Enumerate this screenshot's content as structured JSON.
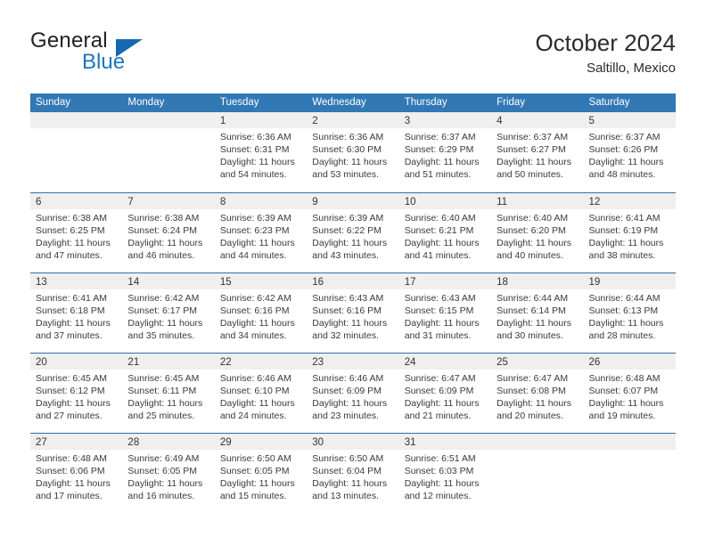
{
  "brand": {
    "name_top": "General",
    "name_bottom": "Blue",
    "triangle_color": "#1668b0",
    "blue_color": "#1b76bc"
  },
  "header": {
    "title": "October 2024",
    "subtitle": "Saltillo, Mexico"
  },
  "theme": {
    "header_bar": "#3178b5",
    "week_divider": "#2f6fa8",
    "day_band": "#efefef"
  },
  "weekdays": [
    "Sunday",
    "Monday",
    "Tuesday",
    "Wednesday",
    "Thursday",
    "Friday",
    "Saturday"
  ],
  "weeks": [
    [
      {
        "day": "",
        "empty": true
      },
      {
        "day": "",
        "empty": true
      },
      {
        "day": "1",
        "sunrise": "Sunrise: 6:36 AM",
        "sunset": "Sunset: 6:31 PM",
        "daylight1": "Daylight: 11 hours",
        "daylight2": "and 54 minutes."
      },
      {
        "day": "2",
        "sunrise": "Sunrise: 6:36 AM",
        "sunset": "Sunset: 6:30 PM",
        "daylight1": "Daylight: 11 hours",
        "daylight2": "and 53 minutes."
      },
      {
        "day": "3",
        "sunrise": "Sunrise: 6:37 AM",
        "sunset": "Sunset: 6:29 PM",
        "daylight1": "Daylight: 11 hours",
        "daylight2": "and 51 minutes."
      },
      {
        "day": "4",
        "sunrise": "Sunrise: 6:37 AM",
        "sunset": "Sunset: 6:27 PM",
        "daylight1": "Daylight: 11 hours",
        "daylight2": "and 50 minutes."
      },
      {
        "day": "5",
        "sunrise": "Sunrise: 6:37 AM",
        "sunset": "Sunset: 6:26 PM",
        "daylight1": "Daylight: 11 hours",
        "daylight2": "and 48 minutes."
      }
    ],
    [
      {
        "day": "6",
        "sunrise": "Sunrise: 6:38 AM",
        "sunset": "Sunset: 6:25 PM",
        "daylight1": "Daylight: 11 hours",
        "daylight2": "and 47 minutes."
      },
      {
        "day": "7",
        "sunrise": "Sunrise: 6:38 AM",
        "sunset": "Sunset: 6:24 PM",
        "daylight1": "Daylight: 11 hours",
        "daylight2": "and 46 minutes."
      },
      {
        "day": "8",
        "sunrise": "Sunrise: 6:39 AM",
        "sunset": "Sunset: 6:23 PM",
        "daylight1": "Daylight: 11 hours",
        "daylight2": "and 44 minutes."
      },
      {
        "day": "9",
        "sunrise": "Sunrise: 6:39 AM",
        "sunset": "Sunset: 6:22 PM",
        "daylight1": "Daylight: 11 hours",
        "daylight2": "and 43 minutes."
      },
      {
        "day": "10",
        "sunrise": "Sunrise: 6:40 AM",
        "sunset": "Sunset: 6:21 PM",
        "daylight1": "Daylight: 11 hours",
        "daylight2": "and 41 minutes."
      },
      {
        "day": "11",
        "sunrise": "Sunrise: 6:40 AM",
        "sunset": "Sunset: 6:20 PM",
        "daylight1": "Daylight: 11 hours",
        "daylight2": "and 40 minutes."
      },
      {
        "day": "12",
        "sunrise": "Sunrise: 6:41 AM",
        "sunset": "Sunset: 6:19 PM",
        "daylight1": "Daylight: 11 hours",
        "daylight2": "and 38 minutes."
      }
    ],
    [
      {
        "day": "13",
        "sunrise": "Sunrise: 6:41 AM",
        "sunset": "Sunset: 6:18 PM",
        "daylight1": "Daylight: 11 hours",
        "daylight2": "and 37 minutes."
      },
      {
        "day": "14",
        "sunrise": "Sunrise: 6:42 AM",
        "sunset": "Sunset: 6:17 PM",
        "daylight1": "Daylight: 11 hours",
        "daylight2": "and 35 minutes."
      },
      {
        "day": "15",
        "sunrise": "Sunrise: 6:42 AM",
        "sunset": "Sunset: 6:16 PM",
        "daylight1": "Daylight: 11 hours",
        "daylight2": "and 34 minutes."
      },
      {
        "day": "16",
        "sunrise": "Sunrise: 6:43 AM",
        "sunset": "Sunset: 6:16 PM",
        "daylight1": "Daylight: 11 hours",
        "daylight2": "and 32 minutes."
      },
      {
        "day": "17",
        "sunrise": "Sunrise: 6:43 AM",
        "sunset": "Sunset: 6:15 PM",
        "daylight1": "Daylight: 11 hours",
        "daylight2": "and 31 minutes."
      },
      {
        "day": "18",
        "sunrise": "Sunrise: 6:44 AM",
        "sunset": "Sunset: 6:14 PM",
        "daylight1": "Daylight: 11 hours",
        "daylight2": "and 30 minutes."
      },
      {
        "day": "19",
        "sunrise": "Sunrise: 6:44 AM",
        "sunset": "Sunset: 6:13 PM",
        "daylight1": "Daylight: 11 hours",
        "daylight2": "and 28 minutes."
      }
    ],
    [
      {
        "day": "20",
        "sunrise": "Sunrise: 6:45 AM",
        "sunset": "Sunset: 6:12 PM",
        "daylight1": "Daylight: 11 hours",
        "daylight2": "and 27 minutes."
      },
      {
        "day": "21",
        "sunrise": "Sunrise: 6:45 AM",
        "sunset": "Sunset: 6:11 PM",
        "daylight1": "Daylight: 11 hours",
        "daylight2": "and 25 minutes."
      },
      {
        "day": "22",
        "sunrise": "Sunrise: 6:46 AM",
        "sunset": "Sunset: 6:10 PM",
        "daylight1": "Daylight: 11 hours",
        "daylight2": "and 24 minutes."
      },
      {
        "day": "23",
        "sunrise": "Sunrise: 6:46 AM",
        "sunset": "Sunset: 6:09 PM",
        "daylight1": "Daylight: 11 hours",
        "daylight2": "and 23 minutes."
      },
      {
        "day": "24",
        "sunrise": "Sunrise: 6:47 AM",
        "sunset": "Sunset: 6:09 PM",
        "daylight1": "Daylight: 11 hours",
        "daylight2": "and 21 minutes."
      },
      {
        "day": "25",
        "sunrise": "Sunrise: 6:47 AM",
        "sunset": "Sunset: 6:08 PM",
        "daylight1": "Daylight: 11 hours",
        "daylight2": "and 20 minutes."
      },
      {
        "day": "26",
        "sunrise": "Sunrise: 6:48 AM",
        "sunset": "Sunset: 6:07 PM",
        "daylight1": "Daylight: 11 hours",
        "daylight2": "and 19 minutes."
      }
    ],
    [
      {
        "day": "27",
        "sunrise": "Sunrise: 6:48 AM",
        "sunset": "Sunset: 6:06 PM",
        "daylight1": "Daylight: 11 hours",
        "daylight2": "and 17 minutes."
      },
      {
        "day": "28",
        "sunrise": "Sunrise: 6:49 AM",
        "sunset": "Sunset: 6:05 PM",
        "daylight1": "Daylight: 11 hours",
        "daylight2": "and 16 minutes."
      },
      {
        "day": "29",
        "sunrise": "Sunrise: 6:50 AM",
        "sunset": "Sunset: 6:05 PM",
        "daylight1": "Daylight: 11 hours",
        "daylight2": "and 15 minutes."
      },
      {
        "day": "30",
        "sunrise": "Sunrise: 6:50 AM",
        "sunset": "Sunset: 6:04 PM",
        "daylight1": "Daylight: 11 hours",
        "daylight2": "and 13 minutes."
      },
      {
        "day": "31",
        "sunrise": "Sunrise: 6:51 AM",
        "sunset": "Sunset: 6:03 PM",
        "daylight1": "Daylight: 11 hours",
        "daylight2": "and 12 minutes."
      },
      {
        "day": "",
        "empty": true
      },
      {
        "day": "",
        "empty": true
      }
    ]
  ]
}
